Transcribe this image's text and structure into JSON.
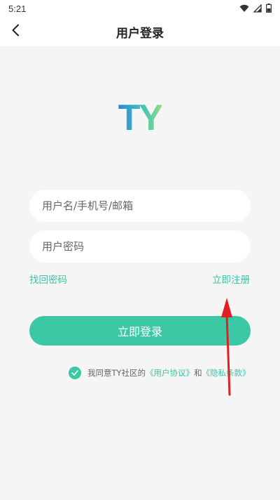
{
  "status_bar": {
    "time": "5:21"
  },
  "nav": {
    "title": "用户登录"
  },
  "logo": {
    "text": "TY"
  },
  "form": {
    "username_placeholder": "用户名/手机号/邮箱",
    "password_placeholder": "用户密码",
    "forgot_password_label": "找回密码",
    "register_label": "立即注册",
    "login_button_label": "立即登录"
  },
  "agreement": {
    "checked": true,
    "prefix": "我同意TY社区的",
    "user_agreement": "《用户协议》",
    "conjunction": "和",
    "privacy_policy": "《隐私条款》"
  },
  "colors": {
    "accent": "#3cc8a4",
    "link": "#3cc3a3",
    "annotation_arrow": "#e02020"
  },
  "icons": {
    "back": "chevron-left-icon",
    "wifi": "wifi-icon",
    "signal": "signal-icon",
    "battery": "battery-icon",
    "check": "check-icon",
    "annotation": "red-arrow-icon"
  }
}
